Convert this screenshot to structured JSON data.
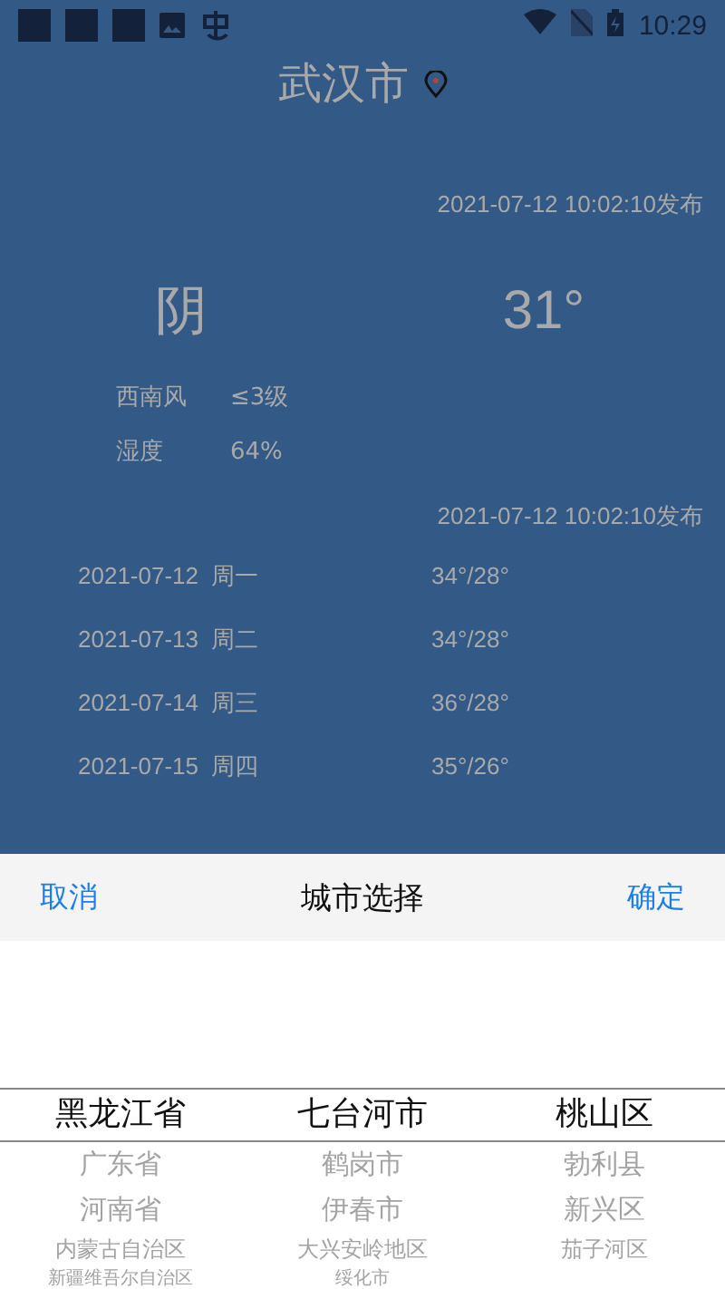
{
  "status_bar": {
    "time": "10:29"
  },
  "city": "武汉市",
  "publish_time": "2021-07-12 10:02:10发布",
  "weather": "阴",
  "temperature": "31°",
  "details": [
    {
      "label": "西南风",
      "value": "≤3级"
    },
    {
      "label": "湿度",
      "value": "64%"
    }
  ],
  "forecast_publish_time": "2021-07-12 10:02:10发布",
  "forecast": [
    {
      "date": "2021-07-12",
      "weekday": "周一",
      "temps": "34°/28°"
    },
    {
      "date": "2021-07-13",
      "weekday": "周二",
      "temps": "34°/28°"
    },
    {
      "date": "2021-07-14",
      "weekday": "周三",
      "temps": "36°/28°"
    },
    {
      "date": "2021-07-15",
      "weekday": "周四",
      "temps": "35°/26°"
    }
  ],
  "picker": {
    "cancel": "取消",
    "title": "城市选择",
    "confirm": "确定",
    "columns": [
      {
        "items": [
          {
            "label": "黑龙江省",
            "selected": true
          },
          {
            "label": "广东省",
            "selected": false
          },
          {
            "label": "河南省",
            "selected": false
          },
          {
            "label": "内蒙古自治区",
            "selected": false
          },
          {
            "label": "新疆维吾尔自治区",
            "selected": false
          }
        ]
      },
      {
        "items": [
          {
            "label": "七台河市",
            "selected": true
          },
          {
            "label": "鹤岗市",
            "selected": false
          },
          {
            "label": "伊春市",
            "selected": false
          },
          {
            "label": "大兴安岭地区",
            "selected": false
          },
          {
            "label": "绥化市",
            "selected": false
          }
        ]
      },
      {
        "items": [
          {
            "label": "桃山区",
            "selected": true
          },
          {
            "label": "勃利县",
            "selected": false
          },
          {
            "label": "新兴区",
            "selected": false
          },
          {
            "label": "茄子河区",
            "selected": false
          }
        ]
      }
    ]
  }
}
